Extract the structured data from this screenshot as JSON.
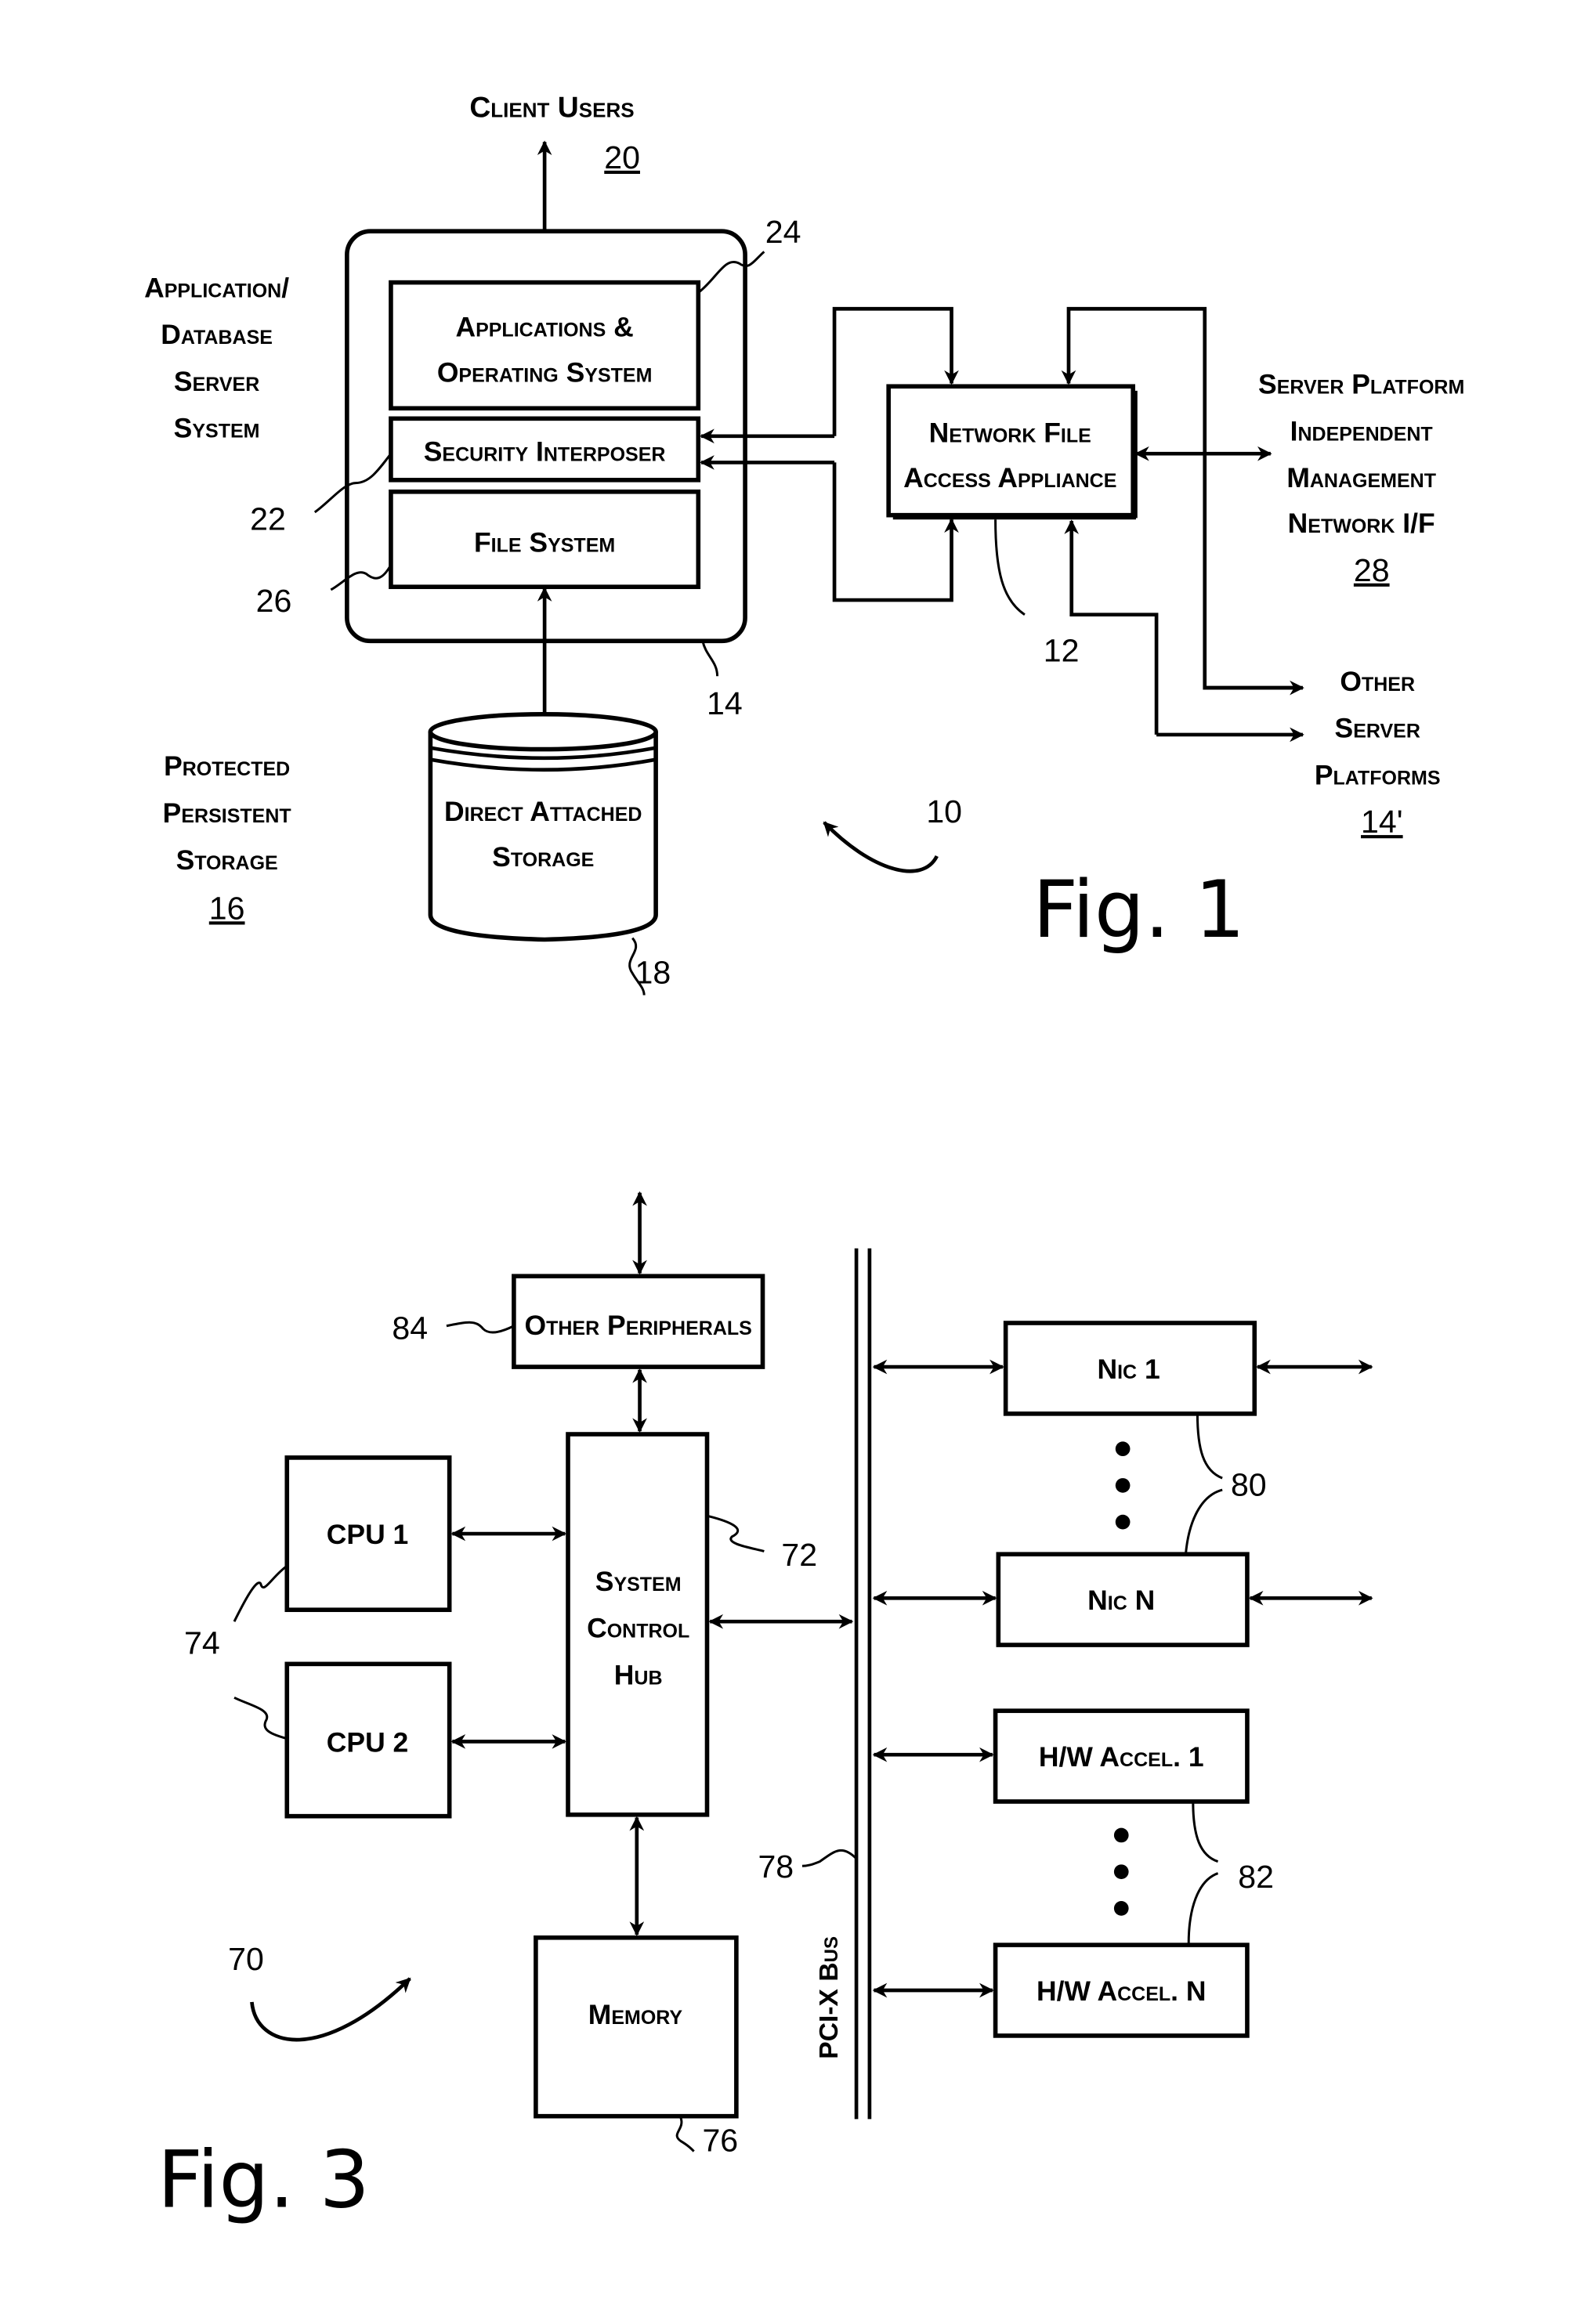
{
  "figure1": {
    "caption": "Fig. 1",
    "ref_system": "10",
    "client_users": {
      "label": "Client Users",
      "ref": "20"
    },
    "server_system_label": [
      "Application/",
      "Database",
      "Server",
      "System"
    ],
    "server_ref": "14",
    "apps_os": {
      "lines": [
        "Applications &",
        "Operating System"
      ],
      "ref": "24"
    },
    "security_interposer": {
      "label": "Security Interposer",
      "ref": "22"
    },
    "file_system": {
      "label": "File System",
      "ref": "26"
    },
    "nfaa": {
      "lines": [
        "Network File",
        "Access Appliance"
      ],
      "ref": "12"
    },
    "mgmt_if": {
      "lines": [
        "Server Platform",
        "Independent",
        "Management",
        "Network I/F"
      ],
      "ref": "28"
    },
    "other_servers": {
      "lines": [
        "Other",
        "Server",
        "Platforms"
      ],
      "ref": "14'"
    },
    "storage_label": {
      "lines": [
        "Protected",
        "Persistent",
        "Storage"
      ],
      "ref": "16"
    },
    "das": {
      "lines": [
        "Direct Attached",
        "Storage"
      ],
      "ref": "18"
    }
  },
  "figure3": {
    "caption": "Fig. 3",
    "ref_system": "70",
    "other_peripherals": {
      "label": "Other Peripherals",
      "ref": "84"
    },
    "hub": {
      "lines": [
        "System",
        "Control",
        "Hub"
      ],
      "ref": "72"
    },
    "cpu1": {
      "label": "CPU 1"
    },
    "cpu2": {
      "label": "CPU 2"
    },
    "cpu_ref": "74",
    "memory": {
      "label": "Memory",
      "ref": "76"
    },
    "bus": {
      "label": "PCI-X Bus",
      "ref": "78"
    },
    "nic1": {
      "label": "Nic 1"
    },
    "nicN": {
      "label": "Nic N"
    },
    "nic_ref": "80",
    "accel1": {
      "label": "H/W Accel. 1"
    },
    "accelN": {
      "label": "H/W Accel. N"
    },
    "accel_ref": "82"
  }
}
